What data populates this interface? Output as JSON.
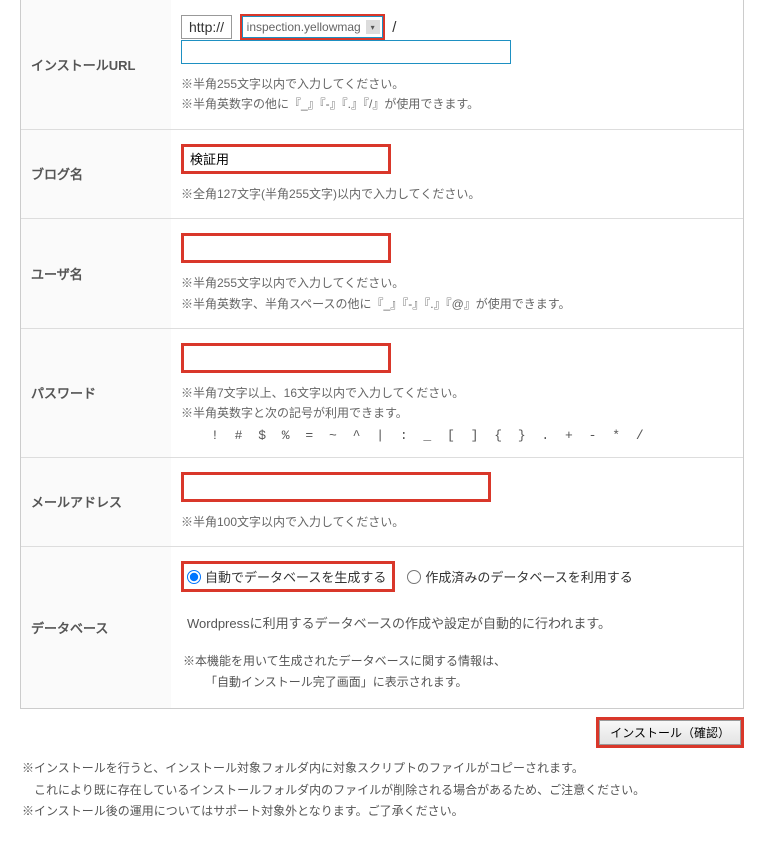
{
  "rows": {
    "installUrl": {
      "label": "インストールURL",
      "scheme": "http://",
      "domain": "inspection.yellowmag",
      "path": "",
      "hint1": "※半角255文字以内で入力してください。",
      "hint2": "※半角英数字の他に『_』『-』『.』『/』が使用できます。"
    },
    "blogName": {
      "label": "ブログ名",
      "value": "検証用",
      "hint": "※全角127文字(半角255文字)以内で入力してください。"
    },
    "username": {
      "label": "ユーザ名",
      "value": "",
      "hint1": "※半角255文字以内で入力してください。",
      "hint2": "※半角英数字、半角スペースの他に『_』『-』『.』『@』が使用できます。"
    },
    "password": {
      "label": "パスワード",
      "value": "",
      "hint1": "※半角7文字以上、16文字以内で入力してください。",
      "hint2": "※半角英数字と次の記号が利用できます。",
      "symbols": "! # $ % = ~ ^ | : _ [ ] { } . + - * /"
    },
    "email": {
      "label": "メールアドレス",
      "value": "",
      "hint": "※半角100文字以内で入力してください。"
    },
    "database": {
      "label": "データベース",
      "optAuto": "自動でデータベースを生成する",
      "optExisting": "作成済みのデータベースを利用する",
      "desc": "Wordpressに利用するデータベースの作成や設定が自動的に行われます。",
      "note1": "※本機能を用いて生成されたデータベースに関する情報は、",
      "note2": "「自動インストール完了画面」に表示されます。"
    }
  },
  "button": {
    "label": "インストール（確認）"
  },
  "footer": {
    "l1": "※インストールを行うと、インストール対象フォルダ内に対象スクリプトのファイルがコピーされます。",
    "l2": "これにより既に存在しているインストールフォルダ内のファイルが削除される場合があるため、ご注意ください。",
    "l3": "※インストール後の運用についてはサポート対象外となります。ご了承ください。"
  }
}
